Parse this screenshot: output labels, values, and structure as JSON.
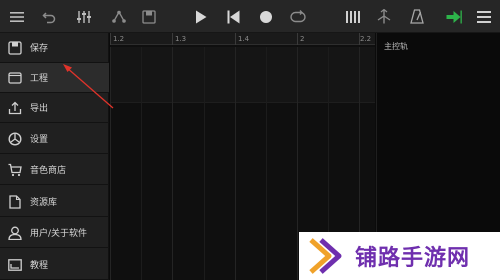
{
  "toolbar": {
    "buttons": [
      "menu-icon",
      "undo-icon",
      "mixer-icon",
      "routing-icon",
      "save-icon",
      "play-icon",
      "rewind-icon",
      "record-icon",
      "loop-icon",
      "piano-icon",
      "tune-icon",
      "metronome-icon",
      "export-arrow-icon",
      "list-icon"
    ],
    "accent": "#2db34a"
  },
  "sidebar": {
    "items": [
      {
        "label": "保存",
        "icon": "save-icon"
      },
      {
        "label": "工程",
        "icon": "folder-icon"
      },
      {
        "label": "导出",
        "icon": "share-icon"
      },
      {
        "label": "设置",
        "icon": "settings-icon"
      },
      {
        "label": "音色商店",
        "icon": "cart-icon"
      },
      {
        "label": "资源库",
        "icon": "document-icon"
      },
      {
        "label": "用户/关于软件",
        "icon": "user-icon"
      },
      {
        "label": "教程",
        "icon": "tutorial-icon"
      }
    ]
  },
  "ruler": {
    "ticks": [
      "1.2",
      "1.3",
      "1.4",
      "2",
      "2.2"
    ]
  },
  "master": {
    "label": "主控轨"
  },
  "annotation": {
    "arrow_color": "#e0332a"
  },
  "watermark": {
    "text": "铺路手游网",
    "color": "#6f2fae"
  }
}
